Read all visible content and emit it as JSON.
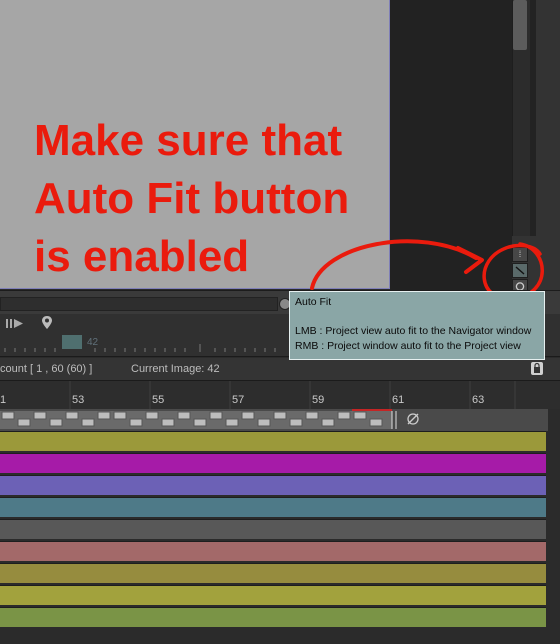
{
  "annotation": {
    "text": "Make sure that\nAuto Fit button\nis enabled",
    "color": "#ea1b0d"
  },
  "tooltip": {
    "title": "Auto Fit",
    "lmb": "LMB : Project view auto fit to the Navigator window",
    "rmb": "RMB : Project window auto fit to the Project view"
  },
  "navigator": {
    "frame_value": "42"
  },
  "status": {
    "count": "count [ 1 , 60  (60) ]",
    "current_image": "Current Image: 42"
  },
  "timeline": {
    "frame_labels": [
      "1",
      "53",
      "55",
      "57",
      "59",
      "61",
      "63"
    ]
  },
  "tracks": [
    "#9b993a",
    "#a61ba8",
    "#6c61b6",
    "#4e7a88",
    "#585858",
    "#a36969",
    "#968c3e",
    "#a2a23d",
    "#7a9446"
  ],
  "icons": [
    "scrollbar",
    "fit-lines-icon",
    "auto-fit-icon",
    "navigator-view-icon",
    "frame-step-icon",
    "play-icon",
    "location-pin-icon",
    "lock-icon",
    "onion-skin-icon"
  ]
}
